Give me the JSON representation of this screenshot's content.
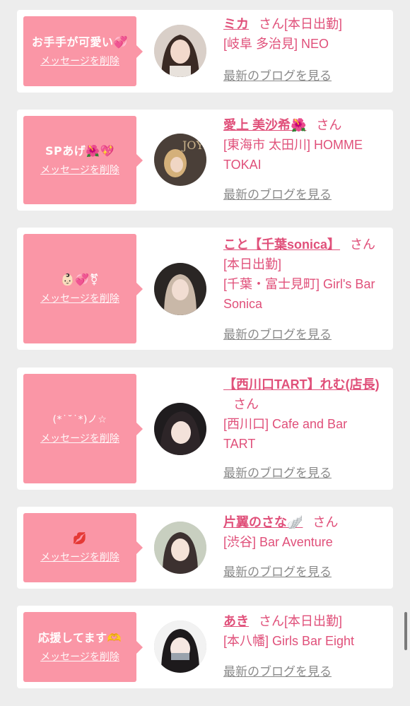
{
  "cards": [
    {
      "message": "お手手が可愛い💞",
      "delete_label": "メッセージを削除",
      "name": "ミカ",
      "suffix": "さん",
      "working": "[本日出勤]",
      "lines": [
        "[岐阜 多治見] NEO"
      ],
      "blog_label": "最新のブログを見る"
    },
    {
      "message": "SPあげ🌺💖",
      "delete_label": "メッセージを削除",
      "name": "愛上 美沙希🌺",
      "suffix": "さん",
      "working": "",
      "lines": [
        "[東海市 太田川] HOMME",
        "TOKAI"
      ],
      "blog_label": "最新のブログを見る"
    },
    {
      "message": "👶🏻💞⚧",
      "delete_label": "メッセージを削除",
      "name": "こと【千葉sonica】",
      "suffix": "さん",
      "working": "",
      "lines": [
        "[本日出勤]",
        "[千葉・富士見町] Girl's Bar",
        "Sonica"
      ],
      "blog_label": "最新のブログを見る"
    },
    {
      "message": "(*˙˘˙*)ノ☆",
      "delete_label": "メッセージを削除",
      "name": "【西川口TART】れむ(店長)",
      "suffix": "さん",
      "working": "",
      "lines": [
        "[西川口] Cafe and Bar",
        "TART"
      ],
      "blog_label": "最新のブログを見る"
    },
    {
      "message": "💋",
      "delete_label": "メッセージを削除",
      "name": "片翼のさな🪽",
      "suffix": "さん",
      "working": "",
      "lines": [
        "[渋谷] Bar Aventure"
      ],
      "blog_label": "最新のブログを見る"
    },
    {
      "message": "応援してます🫶",
      "delete_label": "メッセージを削除",
      "name": "あき",
      "suffix": "さん",
      "working": "[本日出勤]",
      "lines": [
        "[本八幡] Girls Bar Eight"
      ],
      "blog_label": "最新のブログを見る"
    }
  ]
}
